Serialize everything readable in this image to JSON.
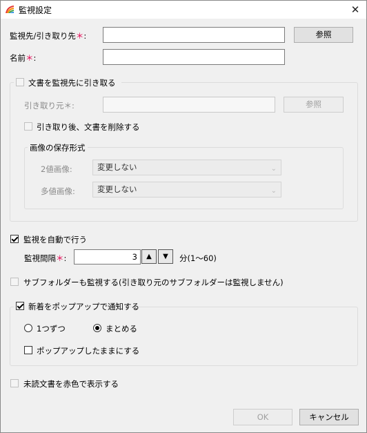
{
  "window": {
    "title": "監視設定",
    "close_label": "✕"
  },
  "target": {
    "label": "監視先/引き取り先",
    "required_mark": "＊",
    "colon": ":",
    "value": "",
    "browse_label": "参照"
  },
  "name": {
    "label": "名前",
    "required_mark": "＊",
    "colon": ":",
    "value": ""
  },
  "monitor_group": {
    "checkbox_label": "文書を監視先に引き取る",
    "source_label": "引き取り元",
    "required_mark": "＊",
    "colon": ":",
    "source_value": "",
    "browse_label": "参照",
    "delete_label": "引き取り後、文書を削除する",
    "image_group": {
      "legend": "画像の保存形式",
      "binary_label": "2値画像:",
      "binary_value": "変更しない",
      "multi_label": "多値画像:",
      "multi_value": "変更しない"
    }
  },
  "auto": {
    "checkbox_label": "監視を自動で行う",
    "interval_label": "監視間隔",
    "required_mark": "＊",
    "colon": ":",
    "interval_value": "3",
    "up_arrow": "▲",
    "down_arrow": "▼",
    "unit_label": "分(1〜60)"
  },
  "subfolder_label": "サブフォルダーも監視する(引き取り元のサブフォルダーは監視しません)",
  "notify": {
    "checkbox_label": "新着をポップアップで通知する",
    "radio_one": "1つずつ",
    "radio_batch": "まとめる",
    "keep_popup_label": "ポップアップしたままにする"
  },
  "unread_label": "未読文書を赤色で表示する",
  "footer": {
    "ok_label": "OK",
    "cancel_label": "キャンセル"
  },
  "colors": {
    "required": "#e3004f",
    "disabled_text": "#8a8a8a",
    "background": "#f0f0f0"
  }
}
